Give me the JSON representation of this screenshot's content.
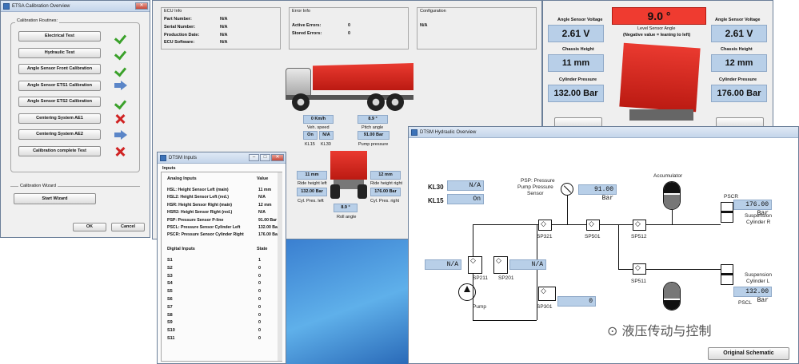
{
  "calib": {
    "title": "ETSA Calibration Overview",
    "routines_label": "Calibration Routines:",
    "routines": [
      {
        "label": "Electrical Test",
        "status": "check"
      },
      {
        "label": "Hydraulic Test",
        "status": "check"
      },
      {
        "label": "Angle Sensor Front Calibration",
        "status": "check"
      },
      {
        "label": "Angle Sensor ETS1 Calibration",
        "status": "arrow"
      },
      {
        "label": "Angle Sensor ETS2 Calibration",
        "status": "check"
      },
      {
        "label": "Centering System AE1",
        "status": "cross"
      },
      {
        "label": "Centering System AE2",
        "status": "arrow"
      },
      {
        "label": "Calibration complete Test",
        "status": "cross"
      }
    ],
    "wizard_label": "Calibration Wizard",
    "start_wizard": "Start Wizard",
    "ok": "OK",
    "cancel": "Cancel"
  },
  "ecu": {
    "ecu_info": "ECU Info",
    "part_number": "Part Number:",
    "part_value": "N/A",
    "serial_number": "Serial Number:",
    "serial_value": "N/A",
    "production_date": "Production Date:",
    "production_value": "N/A",
    "ecu_software": "ECU Software:",
    "software_value": "N/A",
    "error_info": "Error Info",
    "active_errors": "Active Errors:",
    "active_value": "0",
    "stored_errors": "Stored Errors:",
    "stored_value": "0",
    "configuration": "Configuration",
    "config_value": "N/A",
    "veh_speed": "0 Km/h",
    "veh_speed_label": "Veh. speed",
    "pitch": "8.9 °",
    "pitch_label": "Pitch angle",
    "kl15": "On",
    "kl30": "N/A",
    "kl15_label": "KL15",
    "kl30_label": "KL30",
    "pump_pressure": "91.00 Bar",
    "pump_pressure_label": "Pump pressure",
    "ride_left": "11 mm",
    "ride_left_label": "Ride height left",
    "cyl_left": "132.00 Bar",
    "cyl_left_label": "Cyl. Pres. left",
    "ride_right": "12 mm",
    "ride_right_label": "Ride height right",
    "cyl_right": "176.00 Bar",
    "cyl_right_label": "Cyl. Pres. right",
    "roll": "8.9 °",
    "roll_label": "Roll angle"
  },
  "level": {
    "left_voltage_label": "Angle Sensor Voltage",
    "left_voltage": "2.61 V",
    "left_height_label": "Chassis Height",
    "left_height": "11 mm",
    "left_pressure_label": "Cylinder Pressure",
    "left_pressure": "132.00 Bar",
    "angle": "9.0 °",
    "angle_label": "Level Sensor Angle",
    "angle_note": "(Negative value = leaning to left)",
    "right_voltage_label": "Angle Sensor Voltage",
    "right_voltage": "2.61 V",
    "right_height_label": "Chassis Height",
    "right_height": "12 mm",
    "right_pressure_label": "Cylinder Pressure",
    "right_pressure": "176.00 Bar"
  },
  "inputs": {
    "title": "DTSM Inputs",
    "section": "Inputs",
    "analog_header": "Analog Inputs",
    "value_header": "Value",
    "analog": [
      {
        "name": "HSL: Height Sensor Left (main)",
        "value": "11 mm"
      },
      {
        "name": "HSL2: Height Sensor Left (red.)",
        "value": "N/A"
      },
      {
        "name": "HSR: Height Sensor Right (main)",
        "value": "12 mm"
      },
      {
        "name": "HSR2: Height Sensor Right (red.)",
        "value": "N/A"
      },
      {
        "name": "PSP: Pressure Sensor P-line",
        "value": "91.00 Bar"
      },
      {
        "name": "PSCL: Pressure Sensor Cylinder Left",
        "value": "132.00 Bar"
      },
      {
        "name": "PSCR: Pressure Sensor Cylinder Right",
        "value": "176.00 Bar"
      }
    ],
    "digital_header": "Digital Inputs",
    "state_header": "State",
    "digital": [
      {
        "name": "S1",
        "value": "1"
      },
      {
        "name": "S2",
        "value": "0"
      },
      {
        "name": "S3",
        "value": "0"
      },
      {
        "name": "S4",
        "value": "0"
      },
      {
        "name": "S5",
        "value": "0"
      },
      {
        "name": "S6",
        "value": "0"
      },
      {
        "name": "S7",
        "value": "0"
      },
      {
        "name": "S8",
        "value": "0"
      },
      {
        "name": "S9",
        "value": "0"
      },
      {
        "name": "S10",
        "value": "0"
      },
      {
        "name": "S11",
        "value": "0"
      }
    ]
  },
  "hydraulic": {
    "title": "DTSM Hydraulic Overview",
    "kl30_label": "KL30",
    "kl30_value": "N/A",
    "kl15_label": "KL15",
    "kl15_value": "On",
    "psp_label_1": "PSP: Pressure",
    "psp_label_2": "Pump Pressure",
    "psp_label_3": "Sensor",
    "psp_value": "91.00 Bar",
    "accumulator": "Accumulator",
    "pscr": "PSCR",
    "pscr_value": "176.00 Bar",
    "susp_r_1": "Suspension",
    "susp_r_2": "Cylinder R",
    "susp_l_1": "Suspension",
    "susp_l_2": "Cylinder L",
    "pscl": "PSCL",
    "pscl_value": "132.00 Bar",
    "sp321": "SP321",
    "sp501": "SP501",
    "sp512": "SP512",
    "sp511": "SP511",
    "sp211": "SP211",
    "sp201": "SP201",
    "sp301": "SP301",
    "sp211_value": "N/A",
    "sp201_value": "N/A",
    "sp301_value": "0",
    "pump": "Pump",
    "original_schematic": "Original Schematic"
  },
  "watermark": "液压传动与控制"
}
